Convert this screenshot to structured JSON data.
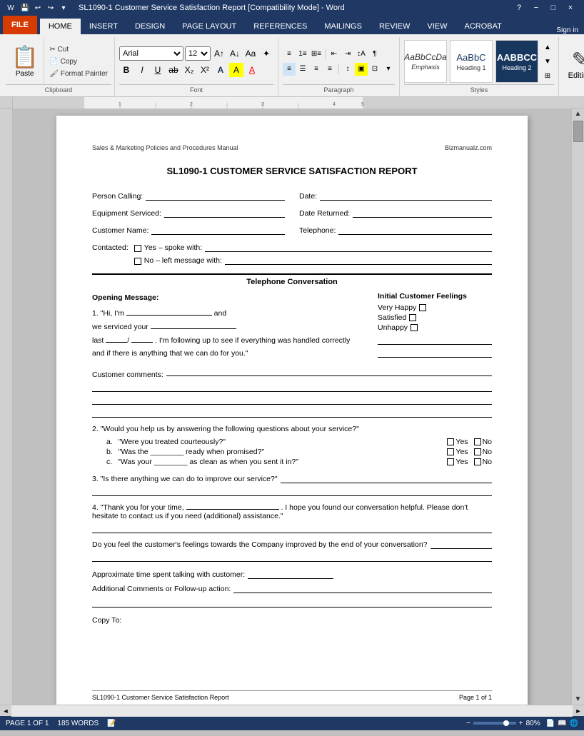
{
  "titleBar": {
    "title": "SL1090-1 Customer Service Satisfaction Report [Compatibility Mode] - Word",
    "helpIcon": "?",
    "controls": [
      "−",
      "□",
      "×"
    ]
  },
  "quickAccess": [
    "save",
    "undo",
    "redo",
    "customize"
  ],
  "tabs": [
    {
      "label": "FILE",
      "type": "file"
    },
    {
      "label": "HOME",
      "active": true
    },
    {
      "label": "INSERT"
    },
    {
      "label": "DESIGN"
    },
    {
      "label": "PAGE LAYOUT"
    },
    {
      "label": "REFERENCES"
    },
    {
      "label": "MAILINGS"
    },
    {
      "label": "REVIEW"
    },
    {
      "label": "VIEW"
    },
    {
      "label": "ACROBAT"
    }
  ],
  "ribbon": {
    "clipboard": {
      "label": "Clipboard",
      "paste": "Paste",
      "cut": "Cut",
      "copy": "Copy",
      "painter": "Format Painter"
    },
    "font": {
      "label": "Font",
      "name": "Arial",
      "size": "12",
      "buttons": [
        "B",
        "I",
        "U",
        "ab",
        "X₂",
        "X²",
        "A",
        "A"
      ]
    },
    "paragraph": {
      "label": "Paragraph"
    },
    "styles": {
      "label": "Styles",
      "items": [
        {
          "sample": "AaBbCcDa",
          "label": "Emphasis",
          "style": "emphasis"
        },
        {
          "sample": "AaBbC",
          "label": "Heading 1",
          "style": "heading1"
        },
        {
          "sample": "AABBCC",
          "label": "Heading 2",
          "style": "heading2"
        }
      ]
    },
    "editing": {
      "label": "Editing",
      "icon": "✎"
    }
  },
  "document": {
    "header": {
      "left": "Sales & Marketing Policies and Procedures Manual",
      "right": "Bizmanualz.com"
    },
    "title": "SL1090-1 CUSTOMER SERVICE SATISFACTION REPORT",
    "fields": {
      "personCalling": "Person Calling:",
      "date": "Date:",
      "equipmentServiced": "Equipment Serviced:",
      "dateReturned": "Date Returned:",
      "customerName": "Customer Name:",
      "telephone": "Telephone:",
      "contacted": "Contacted:",
      "yesOption": "Yes – spoke with:",
      "noOption": "No – left message with:"
    },
    "section": "Telephone Conversation",
    "openingMessage": {
      "label": "Opening Message:",
      "text1": "1. \"Hi, I'm",
      "and": "and",
      "text2": "we serviced your",
      "text3": "last",
      "slash1": "/",
      "slash2": "/",
      "text4": ". I'm following up to see if everything was handled correctly and if there is anything that we can do for you.\""
    },
    "initialFeelings": {
      "title": "Initial Customer Feelings",
      "options": [
        "Very Happy",
        "Satisfied",
        "Unhappy"
      ]
    },
    "customerComments": "Customer comments:",
    "question2": {
      "label": "2. \"Would you help us by answering the following questions about your service?\"",
      "subQuestions": [
        {
          "letter": "a.",
          "text": "\"Were you treated courteously?\""
        },
        {
          "letter": "b.",
          "text": "\"Was the ________ ready when promised?\""
        },
        {
          "letter": "c.",
          "text": "\"Was your ________ as clean as when you sent it in?\""
        }
      ],
      "yesLabel": "Yes",
      "noLabel": "No"
    },
    "question3": {
      "label": "3. \"Is there anything we can do to improve our service?\""
    },
    "question4": {
      "label": "4. \"Thank you for your time,",
      "text": ". I hope you found our conversation helpful. Please don't hesitate to contact us if you need (additional) assistance.\""
    },
    "doYouFeel": "Do you feel the customer's feelings towards the Company improved by the end of your conversation?",
    "approxTime": "Approximate time spent talking with customer:",
    "additionalComments": "Additional Comments or Follow-up action:",
    "copyTo": "Copy To:",
    "footer": {
      "left": "SL1090-1 Customer Service Satisfaction Report",
      "right": "Page 1 of 1"
    }
  },
  "statusBar": {
    "page": "PAGE 1 OF 1",
    "words": "185 WORDS",
    "zoom": "80%"
  }
}
